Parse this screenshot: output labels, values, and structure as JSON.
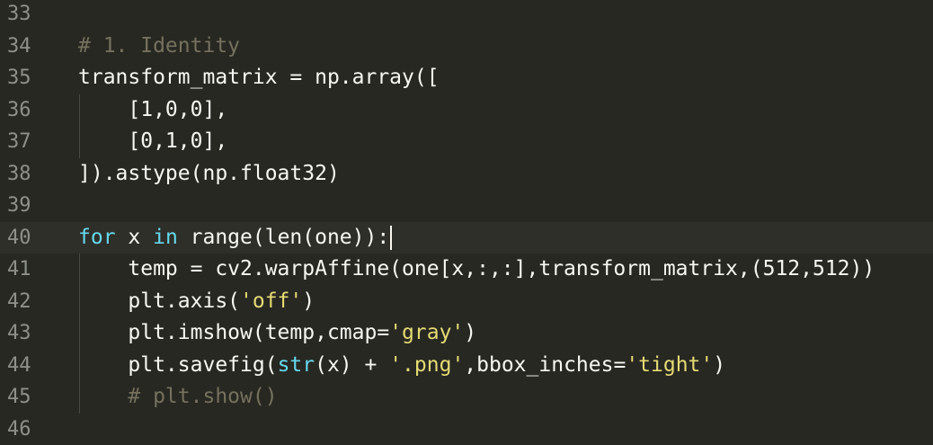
{
  "editor": {
    "theme_colors": {
      "background": "#272822",
      "text": "#f8f8f2",
      "comment": "#75715e",
      "keyword": "#66d9ef",
      "string": "#e6db74",
      "line_number": "#8f908a"
    },
    "cursor_line": "40",
    "lines": [
      {
        "num": "33",
        "parts": []
      },
      {
        "num": "34",
        "parts": [
          {
            "t": "# 1. Identity",
            "c": "cmt"
          }
        ]
      },
      {
        "num": "35",
        "parts": [
          {
            "t": "transform_matrix = np.array([",
            "c": ""
          }
        ]
      },
      {
        "num": "36",
        "parts": [
          {
            "t": "    [1,0,0],",
            "c": ""
          }
        ]
      },
      {
        "num": "37",
        "parts": [
          {
            "t": "    [0,1,0],",
            "c": ""
          }
        ]
      },
      {
        "num": "38",
        "parts": [
          {
            "t": "]).astype(np.float32)",
            "c": ""
          }
        ]
      },
      {
        "num": "39",
        "parts": []
      },
      {
        "num": "40",
        "parts": [
          {
            "t": "for",
            "c": "kw"
          },
          {
            "t": " x ",
            "c": ""
          },
          {
            "t": "in",
            "c": "kw"
          },
          {
            "t": " range(len(one)):",
            "c": ""
          }
        ]
      },
      {
        "num": "41",
        "parts": [
          {
            "t": "    temp = cv2.warpAffine(one[x,:,:],transform_matrix,(512,512))",
            "c": ""
          }
        ]
      },
      {
        "num": "42",
        "parts": [
          {
            "t": "    plt.axis(",
            "c": ""
          },
          {
            "t": "'off'",
            "c": "str"
          },
          {
            "t": ")",
            "c": ""
          }
        ]
      },
      {
        "num": "43",
        "parts": [
          {
            "t": "    plt.imshow(temp,cmap=",
            "c": ""
          },
          {
            "t": "'gray'",
            "c": "str"
          },
          {
            "t": ")",
            "c": ""
          }
        ]
      },
      {
        "num": "44",
        "parts": [
          {
            "t": "    plt.savefig(",
            "c": ""
          },
          {
            "t": "str",
            "c": "kw"
          },
          {
            "t": "(x) + ",
            "c": ""
          },
          {
            "t": "'.png'",
            "c": "str"
          },
          {
            "t": ",bbox_inches=",
            "c": ""
          },
          {
            "t": "'tight'",
            "c": "str"
          },
          {
            "t": ")",
            "c": ""
          }
        ]
      },
      {
        "num": "45",
        "parts": [
          {
            "t": "    ",
            "c": ""
          },
          {
            "t": "# plt.show()",
            "c": "cmt"
          }
        ]
      },
      {
        "num": "46",
        "parts": []
      }
    ]
  }
}
